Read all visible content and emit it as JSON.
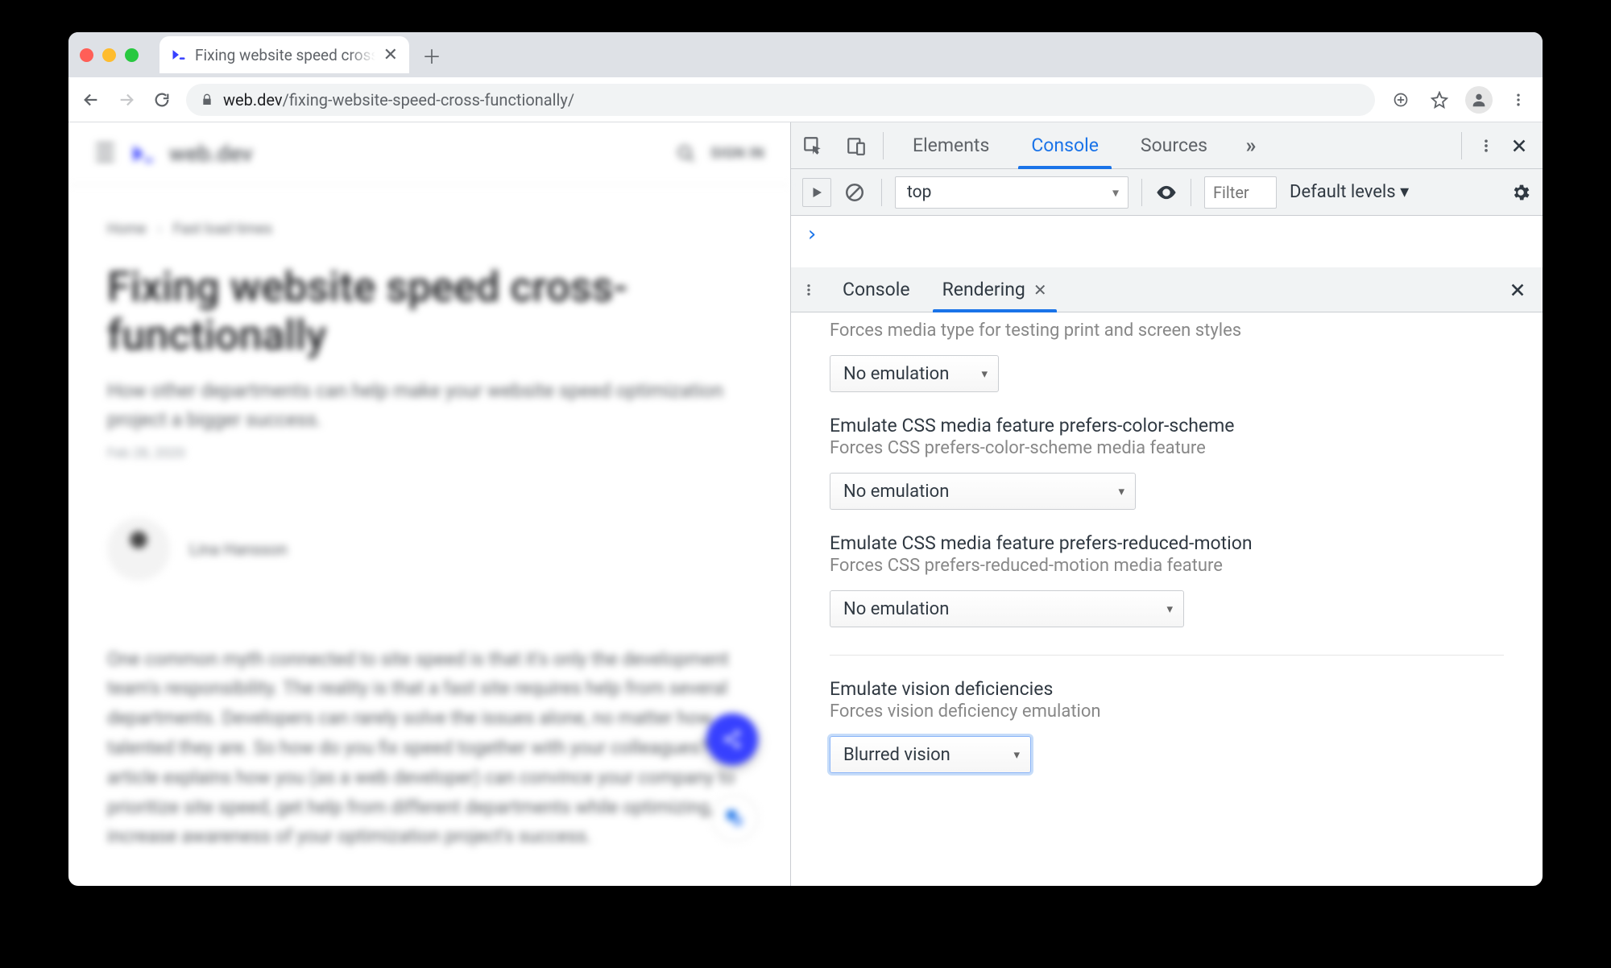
{
  "window": {
    "tab_title": "Fixing website speed cross-fun",
    "url_host": "web.dev",
    "url_path": "/fixing-website-speed-cross-functionally/"
  },
  "page": {
    "brand": "web.dev",
    "signin": "SIGN IN",
    "crumb_home": "Home",
    "crumb_section": "Fast load times",
    "title": "Fixing website speed cross-functionally",
    "subtitle": "How other departments can help make your website speed optimization project a bigger success.",
    "date": "Feb 28, 2020",
    "author": "Lina Hansson",
    "paragraph": "One common myth connected to site speed is that it's only the development team's responsibility. The reality is that a fast site requires help from several departments. Developers can rarely solve the issues alone, no matter how talented they are. So how do you fix speed together with your colleagues? This article explains how you (as a web developer) can convince your company to prioritize site speed, get help from different departments while optimizing, and increase awareness of your optimization project's success."
  },
  "devtools": {
    "tabs": {
      "elements": "Elements",
      "console": "Console",
      "sources": "Sources"
    },
    "active_tab": "Console",
    "console_bar": {
      "context": "top",
      "filter_placeholder": "Filter",
      "levels": "Default levels ▾"
    },
    "drawer": {
      "tabs": {
        "console": "Console",
        "rendering": "Rendering"
      },
      "active": "Rendering"
    },
    "rendering": {
      "media_type_desc": "Forces media type for testing print and screen styles",
      "media_type_value": "No emulation",
      "color_scheme_title": "Emulate CSS media feature prefers-color-scheme",
      "color_scheme_desc": "Forces CSS prefers-color-scheme media feature",
      "color_scheme_value": "No emulation",
      "reduced_motion_title": "Emulate CSS media feature prefers-reduced-motion",
      "reduced_motion_desc": "Forces CSS prefers-reduced-motion media feature",
      "reduced_motion_value": "No emulation",
      "vision_title": "Emulate vision deficiencies",
      "vision_desc": "Forces vision deficiency emulation",
      "vision_value": "Blurred vision"
    }
  }
}
